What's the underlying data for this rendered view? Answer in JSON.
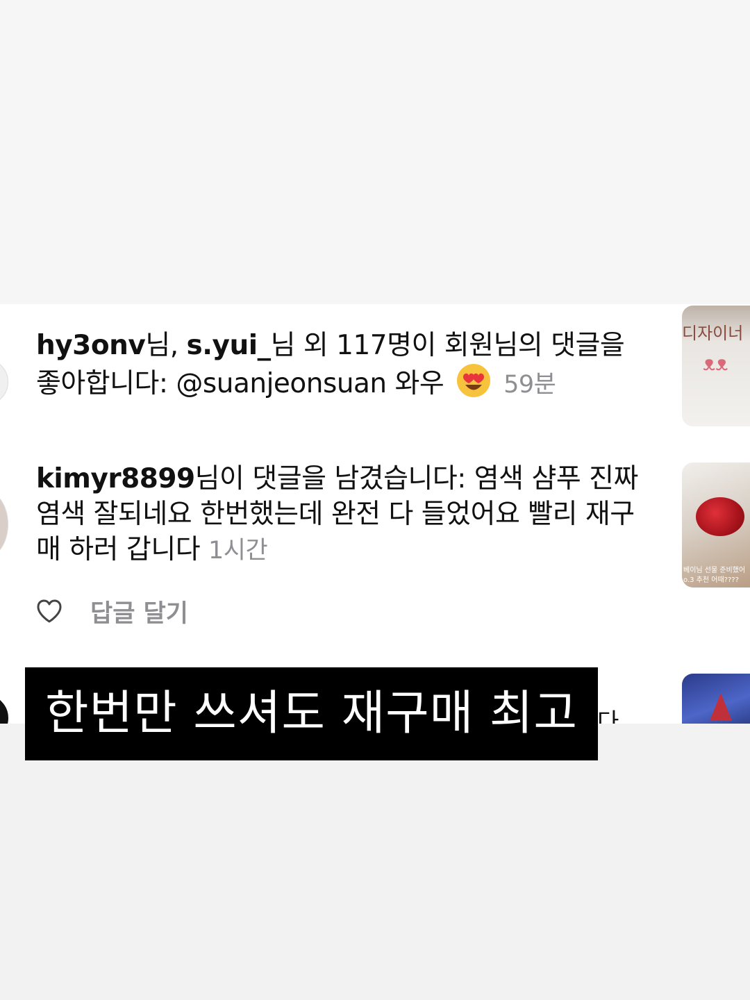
{
  "notifications": [
    {
      "users_text": "hy3onv",
      "segments": {
        "u1": "hy3onv",
        "t1": "님, ",
        "u2": "s.yui_",
        "t2": "님 외 117명이 회원님의 댓글을 좋아합니다: @suanjeonsuan 와우"
      },
      "emoji": "heart-eyes-emoji",
      "time": "59분"
    },
    {
      "user": "kimyr8899",
      "text": "님이 댓글을 남겼습니다: 염색 샴푸 진짜  염색 잘되네요 한번했는데 완전 다 들었어요 빨리 재구매 하러 갑니다",
      "time": "1시간"
    }
  ],
  "actions": {
    "like_icon": "heart-outline-icon",
    "reply_label": "답글 달기"
  },
  "thumbnails": {
    "t1_text": "디자이너",
    "t2_caption_1": "베이님 선물 준비했어",
    "t2_caption_2": "o.3 추천 어때????"
  },
  "partial_text": "다",
  "caption": "한번만 쓰셔도 재구매 최고"
}
